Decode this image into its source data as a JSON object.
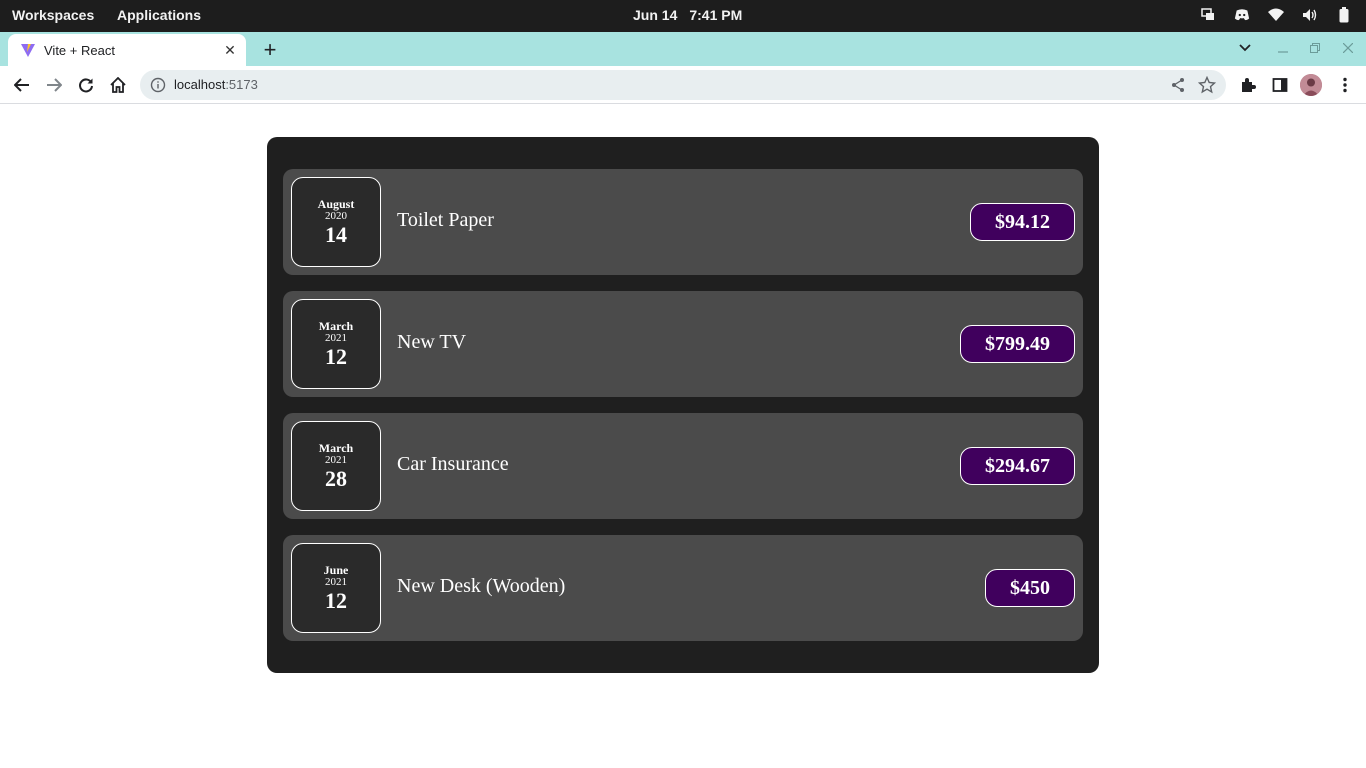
{
  "system_bar": {
    "workspaces": "Workspaces",
    "applications": "Applications",
    "date": "Jun 14",
    "time": "7:41 PM"
  },
  "browser": {
    "tab_title": "Vite + React",
    "url_host": "localhost",
    "url_port": ":5173"
  },
  "expenses": [
    {
      "month": "August",
      "year": "2020",
      "day": "14",
      "title": "Toilet Paper",
      "amount": "$94.12"
    },
    {
      "month": "March",
      "year": "2021",
      "day": "12",
      "title": "New TV",
      "amount": "$799.49"
    },
    {
      "month": "March",
      "year": "2021",
      "day": "28",
      "title": "Car Insurance",
      "amount": "$294.67"
    },
    {
      "month": "June",
      "year": "2021",
      "day": "12",
      "title": "New Desk (Wooden)",
      "amount": "$450"
    }
  ],
  "colors": {
    "card_background": "#1f1f1f",
    "item_background": "#4b4b4b",
    "price_background": "#40005d",
    "tab_strip": "#a8e3e0"
  }
}
